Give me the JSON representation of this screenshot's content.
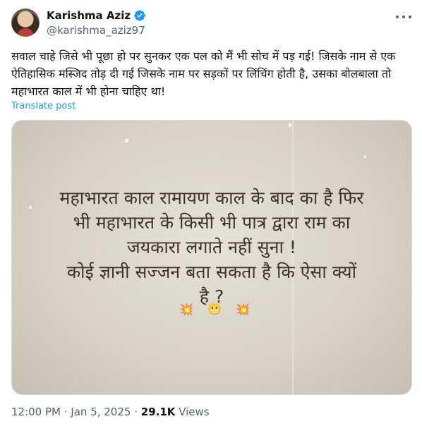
{
  "author": {
    "display_name": "Karishma Aziz",
    "handle": "@karishma_aziz97",
    "avatar_icon": "profile-photo",
    "verified_icon": "verified-badge-icon"
  },
  "post": {
    "text": "सवाल चाहे जिसे भी पूछा हो पर सुनकर एक पल को मैं भी सोच में पड़ गई! जिसके नाम से एक ऐतिहासिक मस्जिद तोड़ दी गई जिसके नाम पर सड़कों पर लिंचिंग होती है, उसका बोलबाला तो महाभारत काल में भी होना चाहिए था!",
    "translate_label": "Translate post",
    "image_text": "महाभारत काल रामायण काल के बाद का है  फिर\nभी महाभारत के किसी भी पात्र द्वारा राम का\nजयकारा लगाते नहीं सुना !\nकोई ज्ञानी सज्जन बता सकता है कि ऐसा क्यों\nहै ?",
    "image_emojis": [
      "💥",
      "😬",
      "💥"
    ]
  },
  "meta": {
    "time": "12:00 PM",
    "separator": " · ",
    "date": "Jan 5, 2025",
    "views_count": "29.1K",
    "views_label": " Views"
  },
  "colors": {
    "link": "#1d9bf0",
    "secondary": "#536471",
    "verified": "#1d9bf0"
  }
}
